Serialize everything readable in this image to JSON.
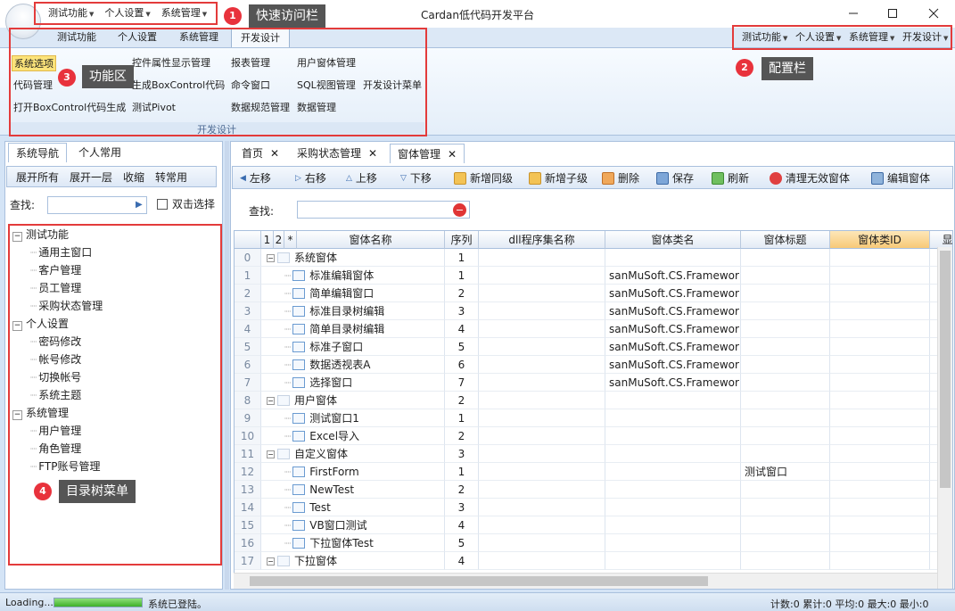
{
  "window": {
    "title": "Cardan低代码开发平台",
    "qat_items": [
      "测试功能",
      "个人设置",
      "系统管理"
    ]
  },
  "ribbon": {
    "tabs": [
      "测试功能",
      "个人设置",
      "系统管理",
      "开发设计"
    ],
    "active_tab": "开发设计",
    "group_label": "开发设计",
    "items": {
      "sys_options": "系统选项",
      "code_mgmt": "代码管理",
      "open_boxcontrol": "打开BoxControl代码生成",
      "prop_display": "控件属性显示管理",
      "gen_boxcontrol": "生成BoxControl代码",
      "test_pivot": "测试Pivot",
      "report_mgmt": "报表管理",
      "cmd_window": "命令窗口",
      "data_spec": "数据规范管理",
      "user_form": "用户窗体管理",
      "sql_view": "SQL视图管理",
      "data_mgmt": "数据管理",
      "dev_menu": "开发设计菜单"
    },
    "config_items": [
      "测试功能",
      "个人设置",
      "系统管理",
      "开发设计"
    ]
  },
  "annotations": [
    {
      "num": "1",
      "label": "快速访问栏"
    },
    {
      "num": "2",
      "label": "配置栏"
    },
    {
      "num": "3",
      "label": "功能区"
    },
    {
      "num": "4",
      "label": "目录树菜单"
    }
  ],
  "left_panel": {
    "tabs": [
      "系统导航",
      "个人常用"
    ],
    "toolbar": [
      "展开所有",
      "展开一层",
      "收缩",
      "转常用"
    ],
    "search_label": "查找:",
    "double_click_label": "双击选择",
    "tree": [
      {
        "label": "测试功能",
        "children": [
          "通用主窗口",
          "客户管理",
          "员工管理",
          "采购状态管理"
        ]
      },
      {
        "label": "个人设置",
        "children": [
          "密码修改",
          "帐号修改",
          "切换帐号",
          "系统主题"
        ]
      },
      {
        "label": "系统管理",
        "children": [
          "用户管理",
          "角色管理",
          "FTP账号管理"
        ]
      }
    ]
  },
  "doc_tabs": [
    "首页",
    "采购状态管理",
    "窗体管理"
  ],
  "active_doc_tab": "窗体管理",
  "toolbar": [
    "左移",
    "右移",
    "上移",
    "下移",
    "新增同级",
    "新增子级",
    "删除",
    "保存",
    "刷新",
    "清理无效窗体",
    "编辑窗体"
  ],
  "search_label": "查找:",
  "grid": {
    "level_headers": [
      "1",
      "2",
      "*"
    ],
    "columns": [
      "窗体名称",
      "序列",
      "dll程序集名称",
      "窗体类名",
      "窗体标题",
      "窗体类ID",
      "显"
    ],
    "rows": [
      {
        "n": "0",
        "lvl": 0,
        "name": "系统窗体",
        "seq": "1",
        "cls": "",
        "title": ""
      },
      {
        "n": "1",
        "lvl": 1,
        "name": "标准编辑窗体",
        "seq": "1",
        "cls": "sanMuSoft.CS.Framework",
        "title": ""
      },
      {
        "n": "2",
        "lvl": 1,
        "name": "简单编辑窗口",
        "seq": "2",
        "cls": "sanMuSoft.CS.Framework",
        "title": ""
      },
      {
        "n": "3",
        "lvl": 1,
        "name": "标准目录树编辑",
        "seq": "3",
        "cls": "sanMuSoft.CS.Framework",
        "title": ""
      },
      {
        "n": "4",
        "lvl": 1,
        "name": "简单目录树编辑",
        "seq": "4",
        "cls": "sanMuSoft.CS.Framework",
        "title": ""
      },
      {
        "n": "5",
        "lvl": 1,
        "name": "标准子窗口",
        "seq": "5",
        "cls": "sanMuSoft.CS.Framework",
        "title": ""
      },
      {
        "n": "6",
        "lvl": 1,
        "name": "数据透视表A",
        "seq": "6",
        "cls": "sanMuSoft.CS.Framework",
        "title": ""
      },
      {
        "n": "7",
        "lvl": 1,
        "name": "选择窗口",
        "seq": "7",
        "cls": "sanMuSoft.CS.Framework",
        "title": ""
      },
      {
        "n": "8",
        "lvl": 0,
        "name": "用户窗体",
        "seq": "2",
        "cls": "",
        "title": ""
      },
      {
        "n": "9",
        "lvl": 1,
        "name": "测试窗口1",
        "seq": "1",
        "cls": "",
        "title": ""
      },
      {
        "n": "10",
        "lvl": 1,
        "name": "Excel导入",
        "seq": "2",
        "cls": "",
        "title": ""
      },
      {
        "n": "11",
        "lvl": 0,
        "name": "自定义窗体",
        "seq": "3",
        "cls": "",
        "title": ""
      },
      {
        "n": "12",
        "lvl": 1,
        "name": "FirstForm",
        "seq": "1",
        "cls": "",
        "title": "测试窗口"
      },
      {
        "n": "13",
        "lvl": 1,
        "name": "NewTest",
        "seq": "2",
        "cls": "",
        "title": ""
      },
      {
        "n": "14",
        "lvl": 1,
        "name": "Test",
        "seq": "3",
        "cls": "",
        "title": ""
      },
      {
        "n": "15",
        "lvl": 1,
        "name": "VB窗口测试",
        "seq": "4",
        "cls": "",
        "title": ""
      },
      {
        "n": "16",
        "lvl": 1,
        "name": "下拉窗体Test",
        "seq": "5",
        "cls": "",
        "title": ""
      },
      {
        "n": "17",
        "lvl": 0,
        "name": "下拉窗体",
        "seq": "4",
        "cls": "",
        "title": ""
      }
    ]
  },
  "status": {
    "loading": "Loading...",
    "message": "系统已登陆。",
    "stats": "计数:0 累计:0 平均:0 最大:0 最小:0"
  }
}
